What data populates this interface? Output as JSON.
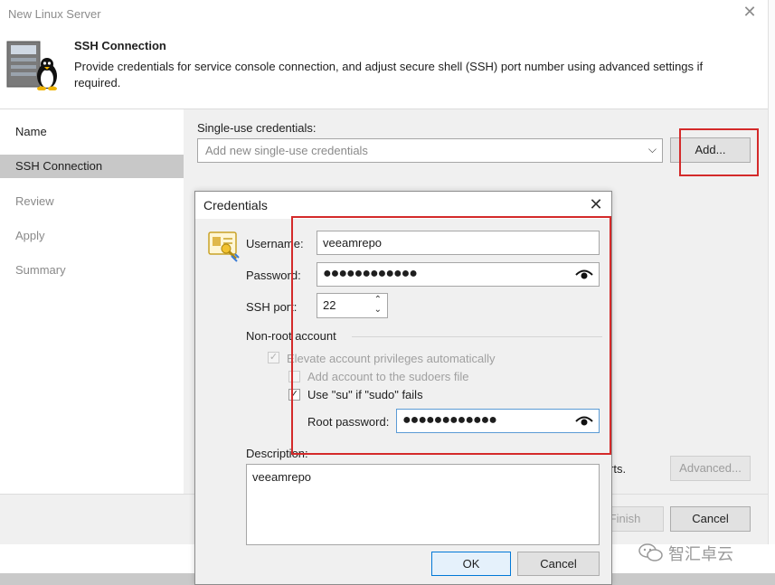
{
  "wizard": {
    "title": "New Linux Server",
    "header_title": "SSH Connection",
    "header_description": "Provide credentials for service console connection, and adjust secure shell (SSH) port number using advanced settings if required.",
    "nav": [
      {
        "label": "Name",
        "state": "done"
      },
      {
        "label": "SSH Connection",
        "state": "active"
      },
      {
        "label": "Review",
        "state": "pending"
      },
      {
        "label": "Apply",
        "state": "pending"
      },
      {
        "label": "Summary",
        "state": "pending"
      }
    ],
    "single_use_label": "Single-use credentials:",
    "single_use_placeholder": "Add new single-use credentials",
    "add_button": "Add...",
    "ports_text": "rts.",
    "advanced_button": "Advanced...",
    "finish_button": "Finish",
    "cancel_button": "Cancel"
  },
  "credentials_dialog": {
    "title": "Credentials",
    "username_label": "Username:",
    "username_value": "veeamrepo",
    "password_label": "Password:",
    "password_mask": "●●●●●●●●●●●●",
    "ssh_port_label": "SSH port:",
    "ssh_port_value": "22",
    "non_root_label": "Non-root account",
    "elevate_label": "Elevate account privileges automatically",
    "elevate_checked": true,
    "sudoers_label": "Add account to the sudoers file",
    "sudoers_checked": false,
    "use_su_label": "Use \"su\" if \"sudo\" fails",
    "use_su_checked": true,
    "root_password_label": "Root password:",
    "root_password_mask": "●●●●●●●●●●●●",
    "description_label": "Description:",
    "description_value": "veeamrepo",
    "ok_button": "OK",
    "cancel_button": "Cancel"
  },
  "watermark": {
    "text": "智汇卓云"
  },
  "colors": {
    "highlight": "#d42a2a",
    "active_nav": "#c8c8c8",
    "focus_border": "#5b9bd5"
  }
}
